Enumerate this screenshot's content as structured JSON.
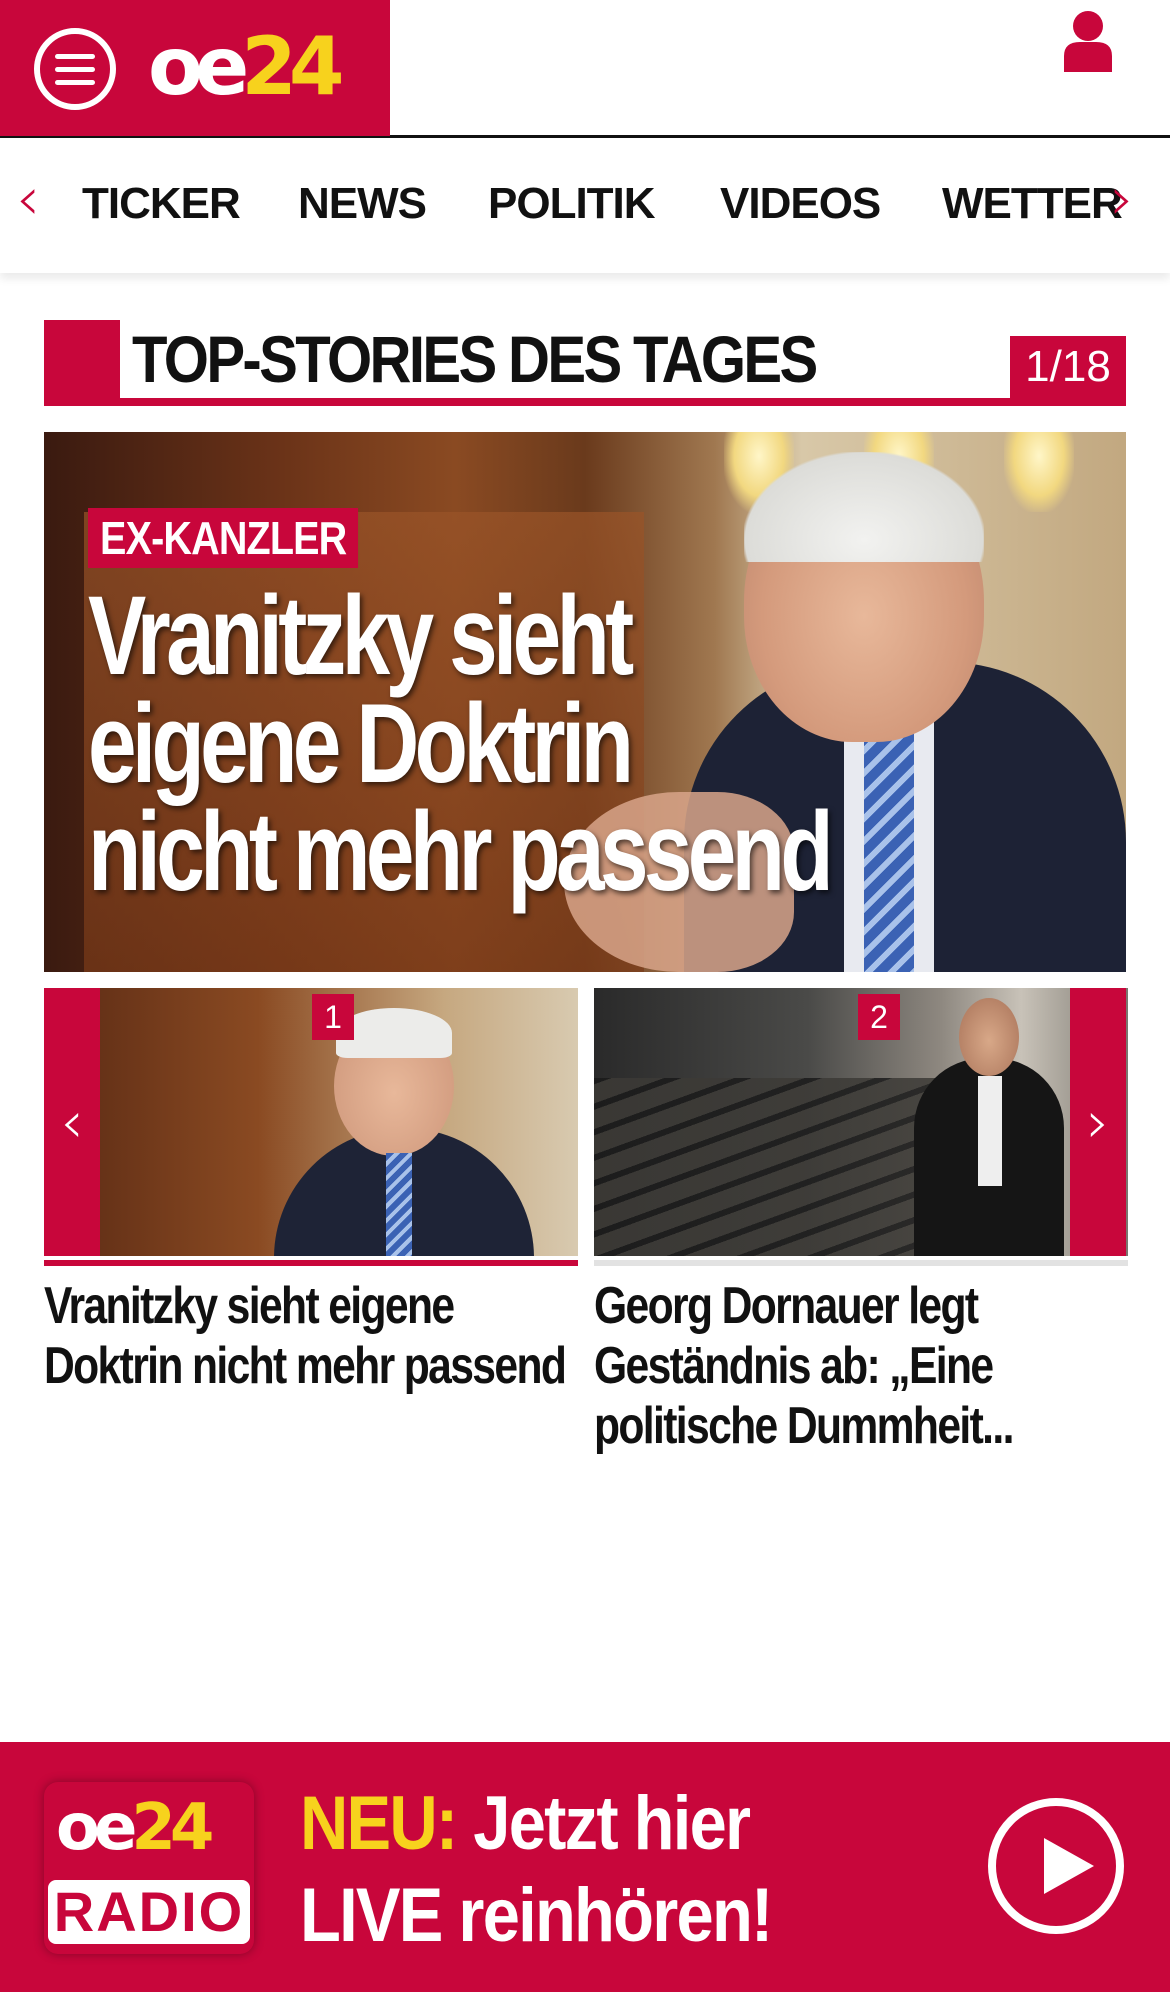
{
  "header": {
    "logo": {
      "oe": "oe",
      "num": "24"
    },
    "menu_icon": "hamburger-menu-icon",
    "user_icon": "user-icon"
  },
  "nav": {
    "items": [
      "TICKER",
      "NEWS",
      "POLITIK",
      "VIDEOS",
      "WETTER"
    ],
    "prev_arrow": "‹",
    "next_arrow": "›"
  },
  "section": {
    "title": "TOP-STORIES DES TAGES",
    "counter": "1/18"
  },
  "hero": {
    "kicker": "EX-KANZLER",
    "headline_lines": [
      "Vranitzky sieht",
      "eigene Doktrin",
      "nicht mehr passend"
    ]
  },
  "carousel": {
    "prev_arrow": "‹",
    "next_arrow": "›",
    "items": [
      {
        "badge": "1",
        "caption": "Vranitzky sieht eigene Doktrin nicht mehr passend"
      },
      {
        "badge": "2",
        "caption": "Georg Dornauer legt Geständnis ab: „Eine politische Dummheit..."
      }
    ]
  },
  "radio": {
    "logo_top_oe": "oe",
    "logo_top_num": "24",
    "logo_bottom": "RADIO",
    "neu": "NEU:",
    "line1_rest": " Jetzt hier",
    "line2": "LIVE reinhören!"
  },
  "colors": {
    "brand_red": "#c8063b",
    "accent_yellow": "#f7d21d"
  }
}
